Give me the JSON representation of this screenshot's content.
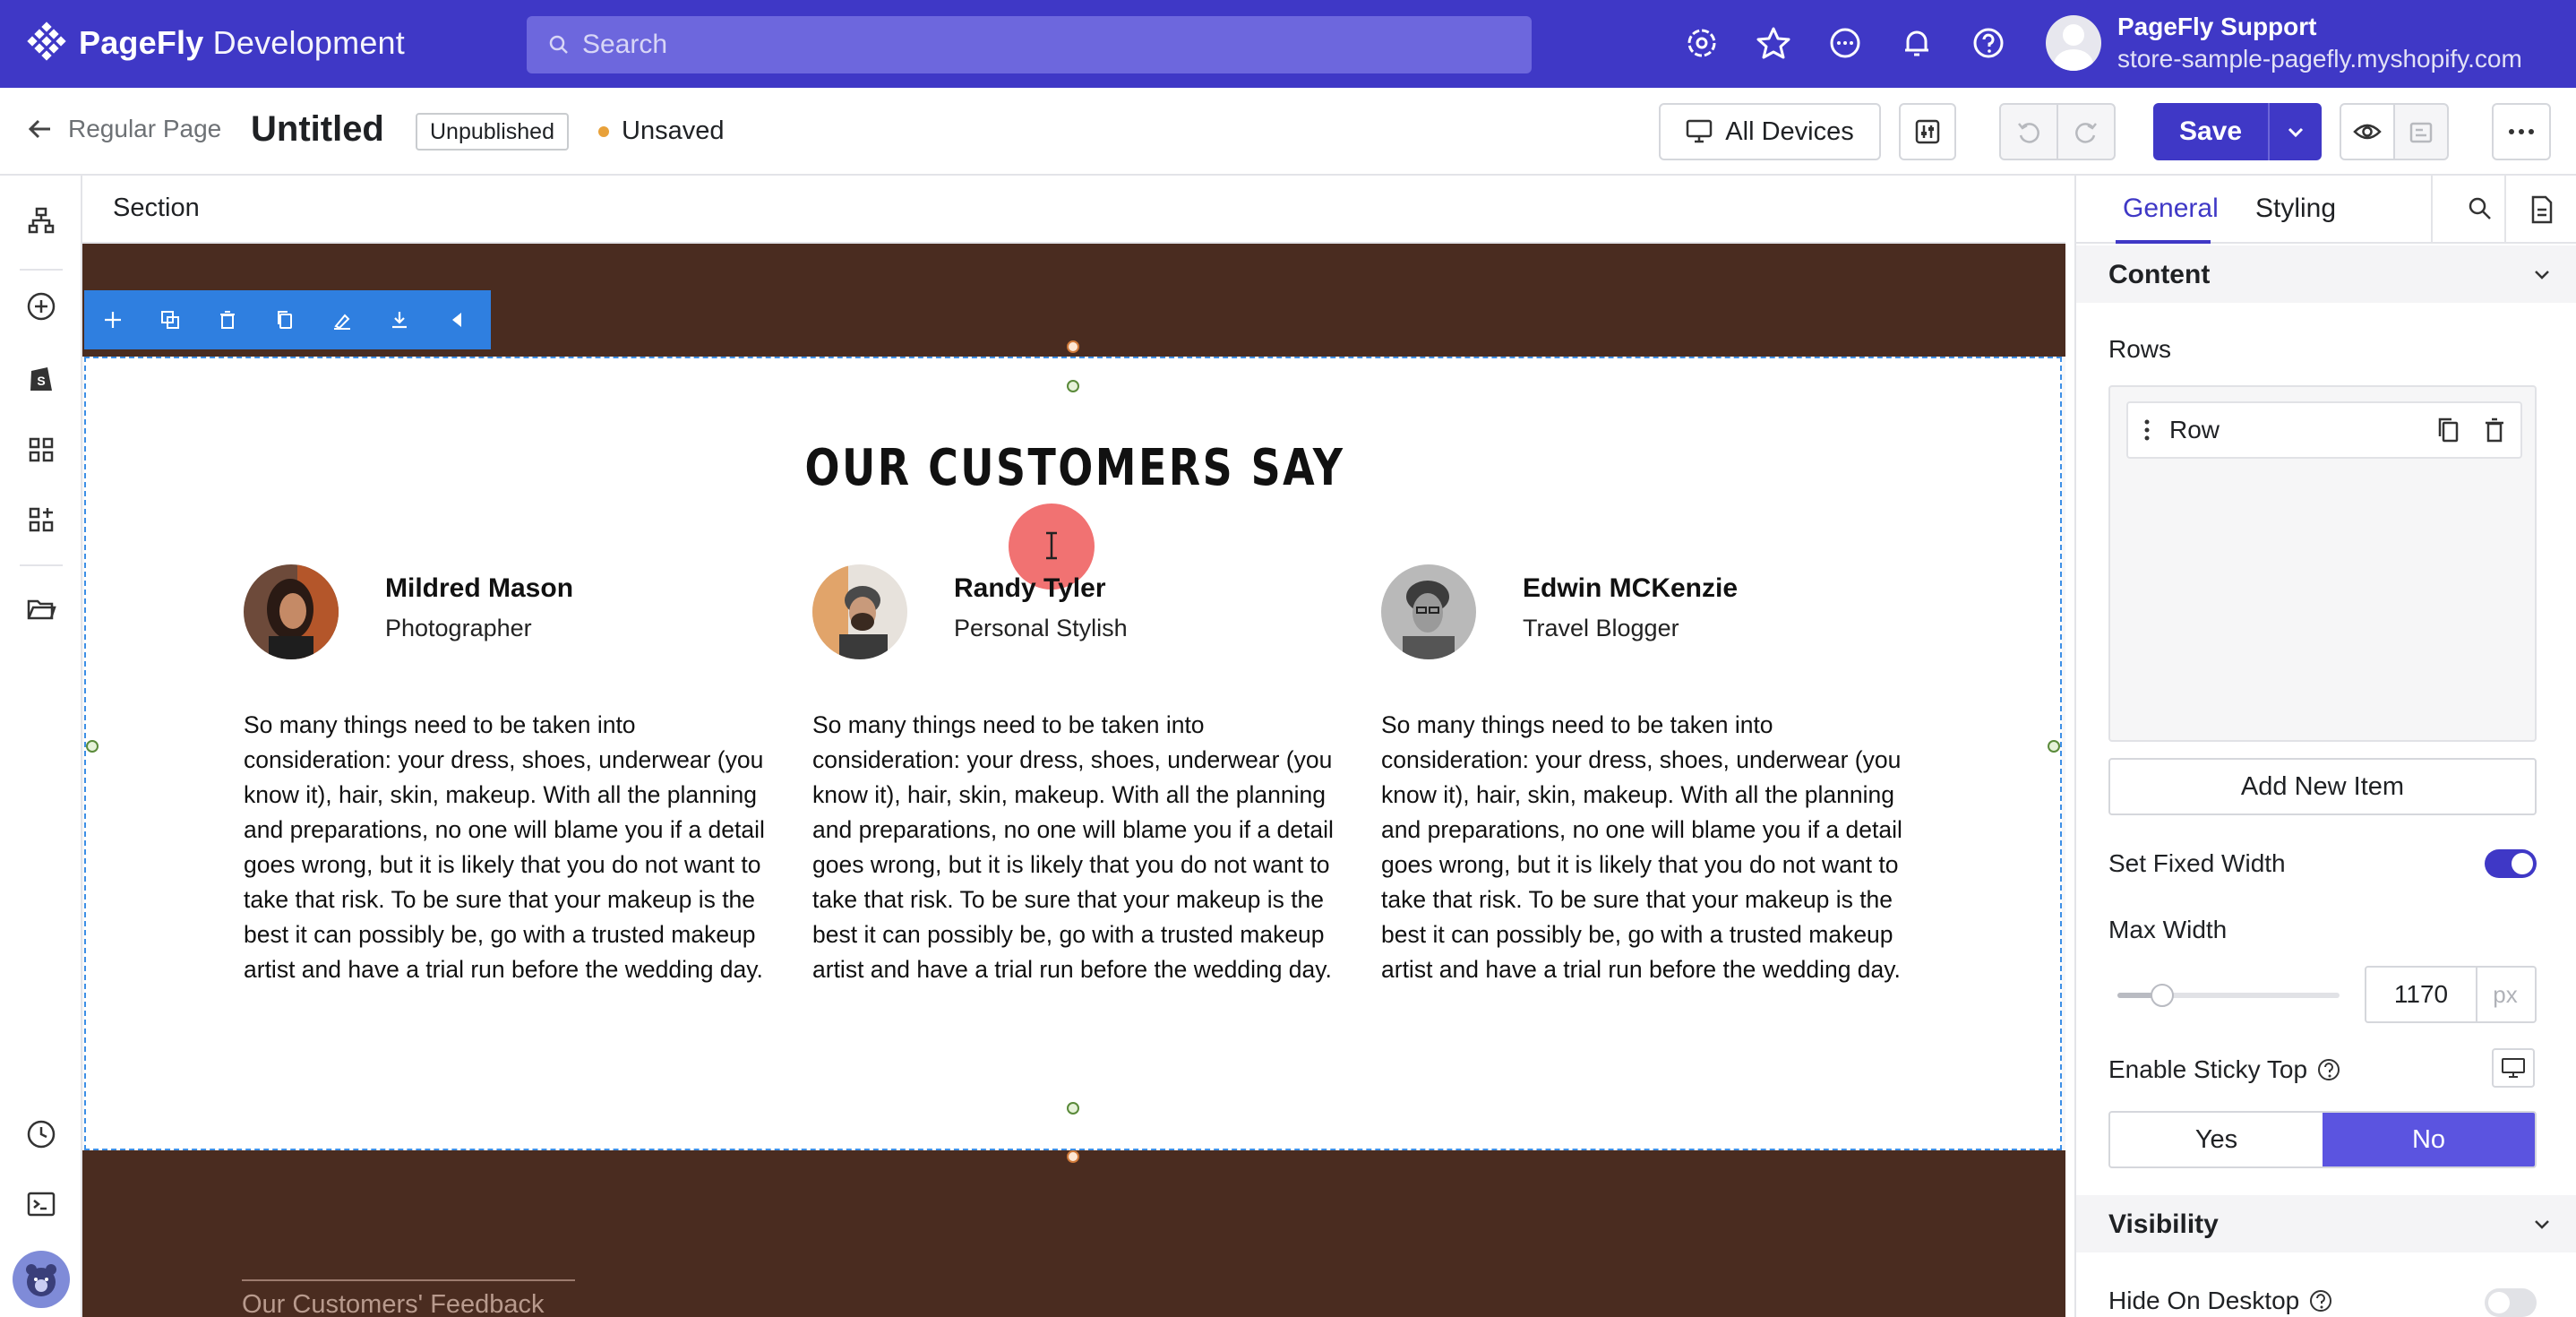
{
  "topbar": {
    "brand": "PageFly",
    "brand_suffix": " Development",
    "search_placeholder": "Search",
    "icons": [
      "settings-cog-icon",
      "star-icon",
      "chat-icon",
      "bell-icon",
      "help-icon"
    ],
    "user_name": "PageFly Support",
    "user_store": "store-sample-pagefly.myshopify.com",
    "accent": "#3f38c6"
  },
  "pagebar": {
    "back_label": "Regular Page",
    "title": "Untitled",
    "status_badge": "Unpublished",
    "save_state": "Unsaved",
    "devices_label": "All Devices",
    "save_label": "Save"
  },
  "sidebar": {
    "icons": [
      "layers-icon",
      "add-element-icon",
      "shopify-icon",
      "grid-icon",
      "apps-icon",
      "folder-icon",
      "history-icon",
      "terminal-icon",
      "avatar-bear-icon"
    ]
  },
  "canvas": {
    "breadcrumb": "Section",
    "heading": "OUR CUSTOMERS SAY",
    "testimonials": [
      {
        "name": "Mildred Mason",
        "role": "Photographer",
        "text": "So many things need to be taken into consideration: your dress, shoes, underwear (you know it), hair, skin, makeup. With all the planning and preparations, no one will blame you if a detail goes wrong, but it is likely that you do not want to take that risk. To be sure that your makeup is the best it can possibly be, go with a trusted makeup artist and have a trial run before the wedding day."
      },
      {
        "name": "Randy Tyler",
        "role": "Personal Stylish",
        "text": "So many things need to be taken into consideration: your dress, shoes, underwear (you know it), hair, skin, makeup. With all the planning and preparations, no one will blame you if a detail goes wrong, but it is likely that you do not want to take that risk. To be sure that your makeup is the best it can possibly be, go with a trusted makeup artist and have a trial run before the wedding day."
      },
      {
        "name": "Edwin MCKenzie",
        "role": "Travel Blogger",
        "text": "So many things need to be taken into consideration: your dress, shoes, underwear (you know it), hair, skin, makeup. With all the planning and preparations, no one will blame you if a detail goes wrong, but it is likely that you do not want to take that risk. To be sure that your makeup is the best it can possibly be, go with a trusted makeup artist and have a trial run before the wedding day."
      }
    ],
    "footer_text": "Our Customers' Feedback",
    "section_bg": "#4a2c20",
    "selection_color": "#2f7fe0"
  },
  "panel": {
    "tabs": [
      "General",
      "Styling"
    ],
    "active_tab": "General",
    "content_title": "Content",
    "rows_label": "Rows",
    "row_item": "Row",
    "add_item": "Add New Item",
    "fixed_width_label": "Set Fixed Width",
    "fixed_width_on": true,
    "max_width_label": "Max Width",
    "max_width_value": "1170",
    "max_width_unit": "px",
    "max_width_slider_fraction": 0.2,
    "sticky_label": "Enable Sticky Top",
    "sticky_options": [
      "Yes",
      "No"
    ],
    "sticky_selected": "No",
    "visibility_title": "Visibility",
    "hide_desktop_label": "Hide On Desktop",
    "hide_desktop_on": false
  }
}
